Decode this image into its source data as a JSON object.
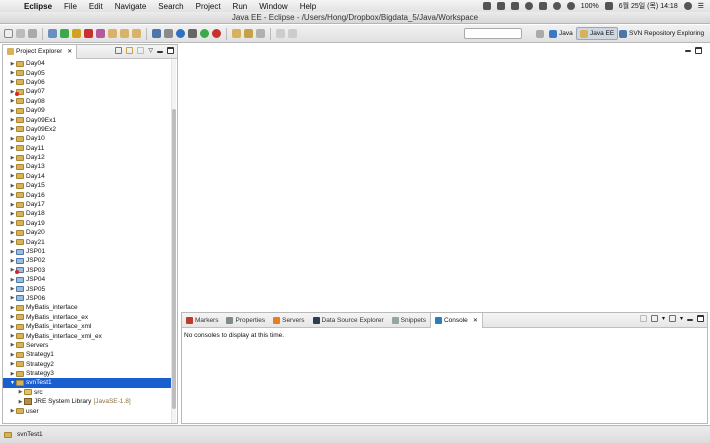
{
  "menubar": {
    "app": "Eclipse",
    "items": [
      "File",
      "Edit",
      "Navigate",
      "Search",
      "Project",
      "Run",
      "Window",
      "Help"
    ],
    "battery": "100%",
    "datetime": "6월 25일 (목)  14:18"
  },
  "window": {
    "title": "Java EE - Eclipse - /Users/Hong/Dropbox/Bigdata_5/Java/Workspace"
  },
  "perspectives": [
    {
      "label": "Java"
    },
    {
      "label": "Java EE"
    },
    {
      "label": "SVN Repository Exploring"
    }
  ],
  "explorer": {
    "title": "Project Explorer",
    "items": [
      {
        "label": "Day04",
        "kind": "folder"
      },
      {
        "label": "Day05",
        "kind": "folder"
      },
      {
        "label": "Day06",
        "kind": "folder"
      },
      {
        "label": "Day07",
        "kind": "folder-err"
      },
      {
        "label": "Day08",
        "kind": "folder"
      },
      {
        "label": "Day09",
        "kind": "folder"
      },
      {
        "label": "Day09Ex1",
        "kind": "folder"
      },
      {
        "label": "Day09Ex2",
        "kind": "folder"
      },
      {
        "label": "Day10",
        "kind": "folder"
      },
      {
        "label": "Day11",
        "kind": "folder"
      },
      {
        "label": "Day12",
        "kind": "folder"
      },
      {
        "label": "Day13",
        "kind": "folder"
      },
      {
        "label": "Day14",
        "kind": "folder"
      },
      {
        "label": "Day15",
        "kind": "folder"
      },
      {
        "label": "Day16",
        "kind": "folder"
      },
      {
        "label": "Day17",
        "kind": "folder"
      },
      {
        "label": "Day18",
        "kind": "folder"
      },
      {
        "label": "Day19",
        "kind": "folder"
      },
      {
        "label": "Day20",
        "kind": "folder"
      },
      {
        "label": "Day21",
        "kind": "folder"
      },
      {
        "label": "JSP01",
        "kind": "web"
      },
      {
        "label": "JSP02",
        "kind": "web"
      },
      {
        "label": "JSP03",
        "kind": "web-err"
      },
      {
        "label": "JSP04",
        "kind": "web"
      },
      {
        "label": "JSP05",
        "kind": "web"
      },
      {
        "label": "JSP06",
        "kind": "web"
      },
      {
        "label": "MyBatis_interface",
        "kind": "folder"
      },
      {
        "label": "MyBatis_interface_ex",
        "kind": "folder"
      },
      {
        "label": "MyBatis_interface_xml",
        "kind": "folder"
      },
      {
        "label": "MyBatis_interface_xml_ex",
        "kind": "folder"
      },
      {
        "label": "Servers",
        "kind": "folder"
      },
      {
        "label": "Strategy1",
        "kind": "folder"
      },
      {
        "label": "Strategy2",
        "kind": "folder"
      },
      {
        "label": "Strategy3",
        "kind": "folder"
      },
      {
        "label": "svnTest1",
        "kind": "folder",
        "expanded": true,
        "selected": true
      },
      {
        "label": "src",
        "kind": "src",
        "indent": 1
      },
      {
        "label": "JRE System Library",
        "detail": "[JavaSE-1.8]",
        "kind": "jar",
        "indent": 1
      },
      {
        "label": "user",
        "kind": "folder"
      }
    ]
  },
  "bottom_tabs": [
    {
      "label": "Markers",
      "color": "#c0392b"
    },
    {
      "label": "Properties",
      "color": "#7f8c8d"
    },
    {
      "label": "Servers",
      "color": "#e67e22"
    },
    {
      "label": "Data Source Explorer",
      "color": "#2c3e50"
    },
    {
      "label": "Snippets",
      "color": "#95a5a6"
    },
    {
      "label": "Console",
      "color": "#2980b9",
      "active": true
    }
  ],
  "console": {
    "message": "No consoles to display at this time."
  },
  "status": {
    "selection": "svnTest1"
  },
  "colors": {
    "selection": "#1a5fd0",
    "folder": "#d8b25a",
    "web_project": "#9bbbe0"
  }
}
